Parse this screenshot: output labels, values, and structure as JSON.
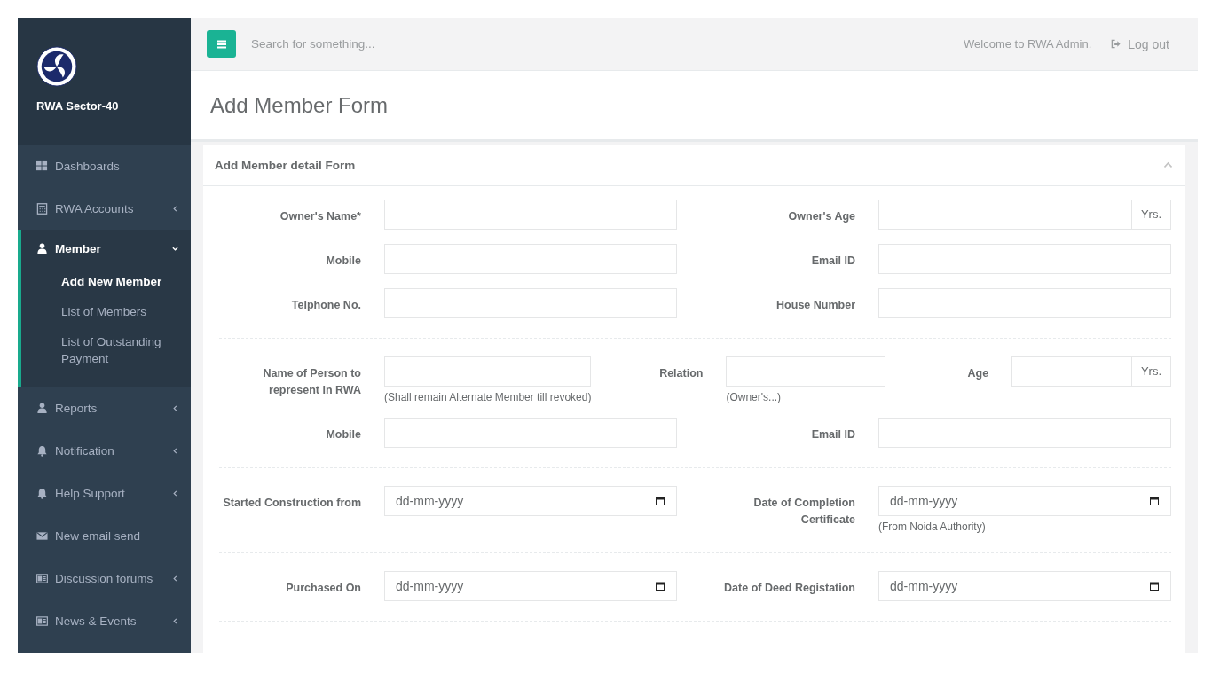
{
  "brand": {
    "name": "RWA Sector-40"
  },
  "sidebar": {
    "items": [
      {
        "label": "Dashboards",
        "selected": false
      },
      {
        "label": "RWA Accounts",
        "selected": false,
        "expanded": false
      },
      {
        "label": "Member",
        "selected": true,
        "expanded": true,
        "children": [
          {
            "label": "Add New Member",
            "selected": true
          },
          {
            "label": "List of Members",
            "selected": false
          },
          {
            "label": "List of Outstanding Payment",
            "selected": false
          }
        ]
      },
      {
        "label": "Reports",
        "selected": false,
        "expanded": false
      },
      {
        "label": "Notification",
        "selected": false,
        "expanded": false
      },
      {
        "label": "Help Support",
        "selected": false,
        "expanded": false
      },
      {
        "label": "New email send",
        "selected": false
      },
      {
        "label": "Discussion forums",
        "selected": false,
        "expanded": false
      },
      {
        "label": "News & Events",
        "selected": false,
        "expanded": false
      }
    ]
  },
  "header": {
    "search": {
      "placeholder": "Search for something..."
    },
    "welcome": "Welcome to RWA Admin.",
    "logout": "Log out"
  },
  "page_title": "Add Member Form",
  "panel": {
    "title": "Add Member detail Form",
    "sections": [
      {
        "rows": [
          {
            "fields": [
              {
                "label": "Owner's Name*",
                "kind": "text"
              },
              {
                "label": "Owner's Age",
                "kind": "addon",
                "addon": "Yrs."
              }
            ]
          },
          {
            "fields": [
              {
                "label": "Mobile",
                "kind": "text"
              },
              {
                "label": "Email ID",
                "kind": "text"
              }
            ]
          },
          {
            "fields": [
              {
                "label": "Telphone No.",
                "kind": "text"
              },
              {
                "label": "House Number",
                "kind": "text"
              }
            ]
          }
        ]
      },
      {
        "rows": [
          {
            "fields": [
              {
                "label": "Name of Person to represent in RWA",
                "kind": "text",
                "help": "(Shall remain Alternate Member till revoked)"
              },
              {
                "label": "Relation",
                "kind": "text",
                "help": "(Owner's...)"
              },
              {
                "label": "Age",
                "kind": "addon",
                "addon": "Yrs."
              }
            ]
          },
          {
            "fields": [
              {
                "label": "Mobile",
                "kind": "text"
              },
              {
                "label": "Email ID",
                "kind": "text"
              }
            ]
          }
        ]
      },
      {
        "rows": [
          {
            "fields": [
              {
                "label": "Started Construction from",
                "kind": "date",
                "placeholder": "dd-mm-yyyy"
              },
              {
                "label": "Date of Completion Certificate",
                "kind": "date",
                "placeholder": "dd-mm-yyyy",
                "help": "(From Noida Authority)"
              }
            ]
          }
        ]
      },
      {
        "rows": [
          {
            "fields": [
              {
                "label": "Purchased On",
                "kind": "date",
                "placeholder": "dd-mm-yyyy"
              },
              {
                "label": "Date of Deed Registation",
                "kind": "date",
                "placeholder": "dd-mm-yyyy"
              }
            ]
          }
        ]
      }
    ]
  }
}
